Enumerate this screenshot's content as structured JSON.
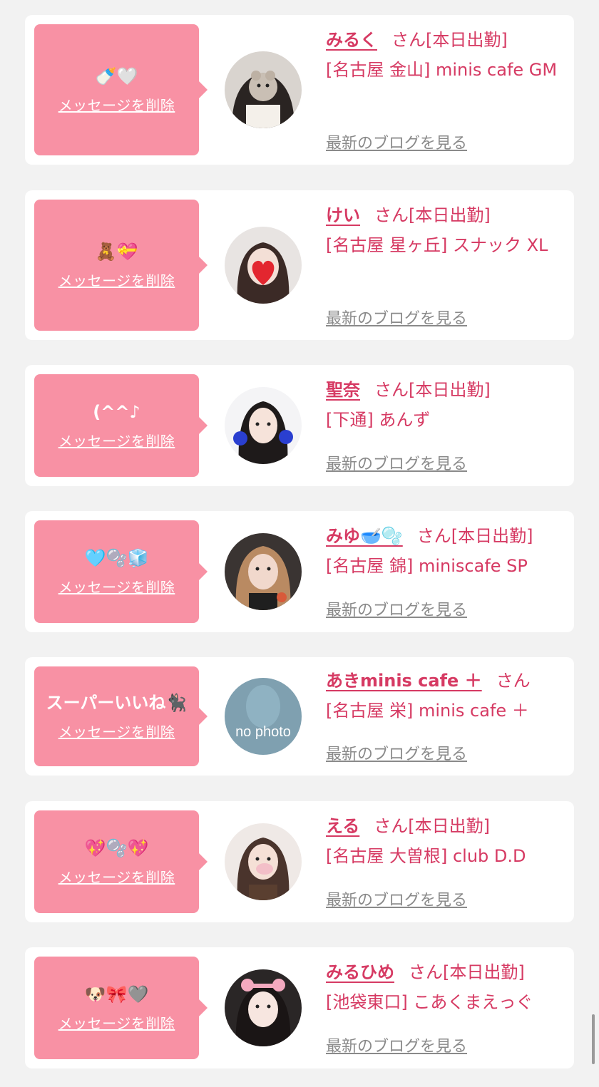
{
  "delete_label": "メッセージを削除",
  "blog_label": "最新のブログを見る",
  "san_label": "さん",
  "colors": {
    "accent": "#d63a63",
    "bubble": "#f891a4",
    "link_gray": "#8a8a8a",
    "background": "#f2f2f2"
  },
  "cards": [
    {
      "message": "🍼🤍",
      "name": "みるく",
      "status": "[本日出勤]",
      "shop": "[名古屋 金山] minis cafe GM",
      "avatar_icon": "profile-photo"
    },
    {
      "message": "🧸💝",
      "name": "けい",
      "status": "[本日出勤]",
      "shop": "[名古屋 星ヶ丘] スナック XL",
      "avatar_icon": "profile-photo"
    },
    {
      "message": "(^^♪",
      "name": "聖奈",
      "status": "[本日出勤]",
      "shop": "[下通] あんず",
      "avatar_icon": "profile-photo"
    },
    {
      "message": "🩵🫧🧊",
      "name": "みゆ🥣🫧",
      "status": "[本日出勤]",
      "shop": "[名古屋 錦] miniscafe SP",
      "avatar_icon": "profile-photo"
    },
    {
      "message": "スーパーいいね🐈‍⬛",
      "name": "あきminis cafe ＋",
      "status": "",
      "shop": "[名古屋 栄] minis cafe ＋",
      "avatar_icon": "no-photo",
      "avatar_text": "no photo"
    },
    {
      "message": "💖🫧💖",
      "name": "える",
      "status": "[本日出勤]",
      "shop": "[名古屋 大曽根] club D.D",
      "avatar_icon": "profile-photo"
    },
    {
      "message": "🐶🎀🩶",
      "name": "みるひめ",
      "status": "[本日出勤]",
      "shop": "[池袋東口] こあくまえっぐ",
      "avatar_icon": "profile-photo"
    }
  ]
}
